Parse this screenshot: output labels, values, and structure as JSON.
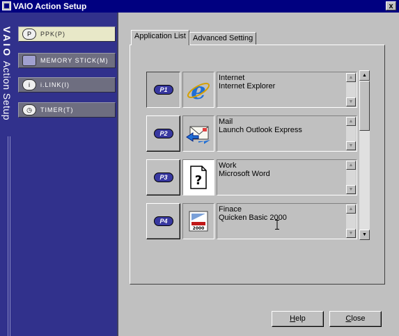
{
  "window": {
    "title": "VAIO Action Setup",
    "close_label": "x"
  },
  "brand": {
    "logo": "VAIO",
    "text": "Action Setup"
  },
  "sidebar": {
    "items": [
      {
        "icon": "ppk-icon",
        "icon_text": "P",
        "label": "PPK(P)",
        "active": true
      },
      {
        "icon": "memory-stick-icon",
        "icon_text": "",
        "label": "MEMORY STICK(M)",
        "active": false
      },
      {
        "icon": "ilink-icon",
        "icon_text": "i",
        "label": "i.LINK(I)",
        "active": false
      },
      {
        "icon": "timer-icon",
        "icon_text": "",
        "label": "TIMER(T)",
        "active": false
      }
    ]
  },
  "tabs": [
    {
      "label": "Application List",
      "active": true
    },
    {
      "label": "Advanced Setting",
      "active": false
    }
  ],
  "applications": [
    {
      "key": "P1",
      "icon": "internet-explorer-icon",
      "line1": "Internet",
      "line2": "Internet Explorer"
    },
    {
      "key": "P2",
      "icon": "outlook-express-icon",
      "line1": "Mail",
      "line2": "Launch Outlook Express"
    },
    {
      "key": "P3",
      "icon": "unknown-document-icon",
      "line1": "Work",
      "line2": "Microsoft Word"
    },
    {
      "key": "P4",
      "icon": "quicken-icon",
      "line1": "Finace",
      "line2": "Quicken Basic 2000",
      "icon_text": "Quicken 2000"
    }
  ],
  "buttons": {
    "help": {
      "mnemonic": "H",
      "rest": "elp"
    },
    "close": {
      "mnemonic": "C",
      "rest": "lose"
    }
  },
  "colors": {
    "title_bar": "#000080",
    "sidebar": "#31318c",
    "active_nav": "#e8e8c8"
  }
}
